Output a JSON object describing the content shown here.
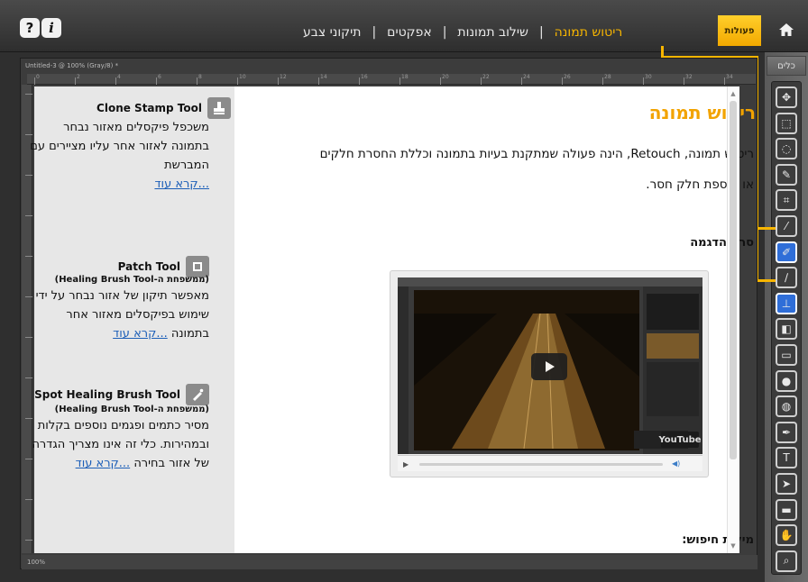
{
  "topbar": {
    "help_label": "?",
    "info_label": "i",
    "actions_label": "פעולות",
    "nav": [
      {
        "label": "ריטוש תמונה",
        "active": true
      },
      {
        "label": "שילוב תמונות",
        "active": false
      },
      {
        "label": "אפקטים",
        "active": false
      },
      {
        "label": "תיקוני צבע",
        "active": false
      }
    ],
    "separator": "|"
  },
  "right_panel": {
    "tools_label": "כלים",
    "tool_icons": [
      "move-icon",
      "marquee-icon",
      "lasso-icon",
      "quick-select-icon",
      "crop-icon",
      "eyedropper-icon",
      "spot-healing-icon",
      "brush-icon",
      "clone-stamp-icon",
      "eraser-icon",
      "gradient-icon",
      "blur-icon",
      "dodge-icon",
      "pen-icon",
      "type-icon",
      "path-select-icon",
      "rectangle-icon",
      "hand-icon",
      "zoom-icon"
    ],
    "highlighted_tools": [
      "spot-healing-icon",
      "clone-stamp-icon"
    ]
  },
  "workspace": {
    "doc_tab": "Untitled-3 @ 100% (Gray/8) *",
    "status_zoom": "100%",
    "ruler_numbers": [
      "0",
      "2",
      "4",
      "6",
      "8",
      "10",
      "12",
      "14",
      "16",
      "18",
      "20",
      "22",
      "24",
      "26",
      "28",
      "30",
      "32",
      "34"
    ]
  },
  "left_tools": [
    {
      "title": "Clone Stamp Tool",
      "icon": "clone-stamp-icon",
      "subtitle": "",
      "desc": "משכפל פיקסלים מאזור נבחר בתמונה לאזור אחר עליו מציירים עם המברשת",
      "readmore": "...קרא עוד"
    },
    {
      "title": "Patch Tool",
      "icon": "patch-icon",
      "subtitle": "(ממשפחת ה-Healing Brush Tool)",
      "desc": "מאפשר תיקון של אזור נבחר על ידי שימוש בפיקסלים מאזור אחר בתמונה",
      "readmore": "...קרא עוד"
    },
    {
      "title": "Spot Healing Brush Tool",
      "icon": "spot-healing-icon",
      "subtitle": "(ממשפחת ה-Healing Brush Tool)",
      "desc": "מסיר כתמים ופגמים נוספים בקלות ובמהירות. כלי זה אינו מצריך הגדרה של אזור בחירה",
      "readmore": "...קרא עוד"
    }
  ],
  "main": {
    "title": "ריטוש תמונה",
    "intro": "ריטוש תמונה, Retouch, הינה פעולה שמתקנת בעיות בתמונה וכללת החסרת חלקים או הוספת חלק חסר.",
    "video_heading": "סרט הדגמה",
    "keywords_heading": "מילות חיפוש:",
    "video_logo": "YouTube"
  },
  "colors": {
    "accent": "#f7b500",
    "title_orange": "#f2a300",
    "link_blue": "#1d5fb8",
    "highlight_blue": "#2f6ed8"
  }
}
